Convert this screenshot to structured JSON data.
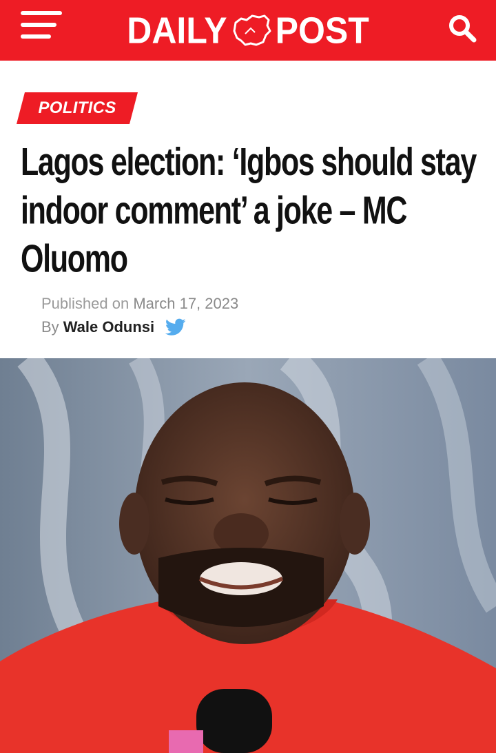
{
  "header": {
    "logo_left": "DAILY",
    "logo_right": "POST",
    "colors": {
      "brand_red": "#ee1c25",
      "white": "#ffffff"
    },
    "icons": {
      "menu": "hamburger-menu-icon",
      "search": "search-icon",
      "logo": "nigeria-map-icon"
    }
  },
  "article": {
    "category": "POLITICS",
    "headline": "Lagos election: ‘Igbos should stay indoor comment’ a joke – MC Oluomo",
    "published_label": "Published on",
    "published_date": "March 17, 2023",
    "by_label": "By",
    "author": "Wale Odunsi",
    "author_social_icon": "twitter-icon",
    "hero_image": "photo-of-man-in-red-shirt-with-microphone"
  }
}
